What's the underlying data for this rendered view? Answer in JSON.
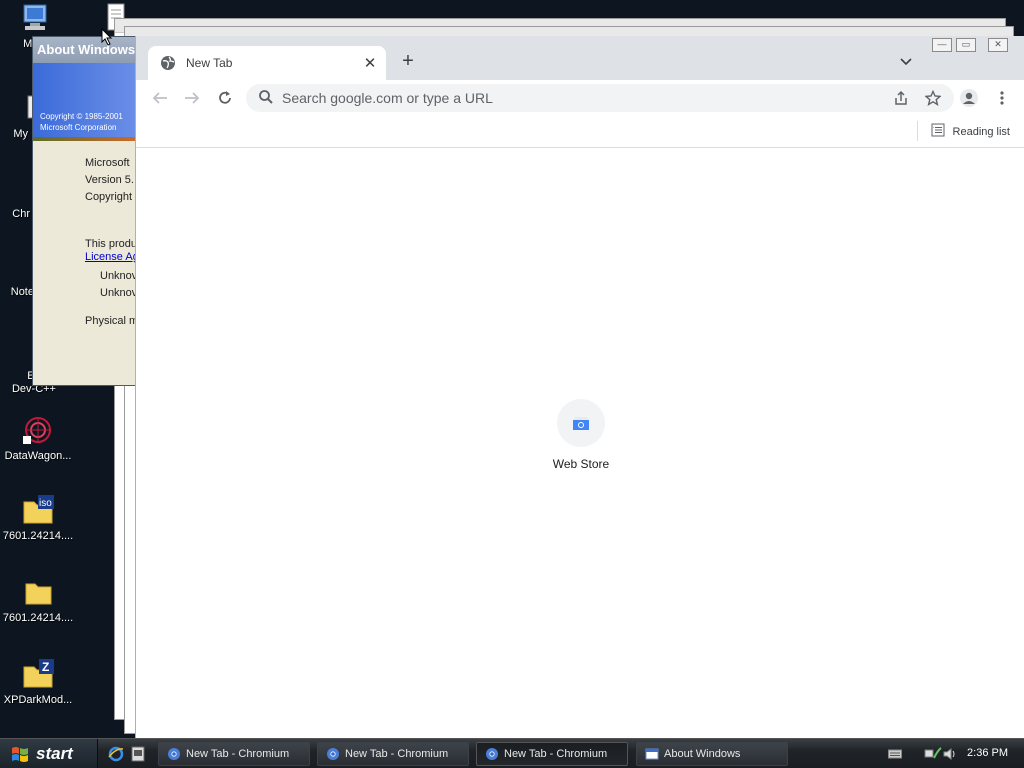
{
  "desktop": {
    "icons": [
      {
        "label": "My C"
      },
      {
        "label": "My"
      },
      {
        "label": "Chr"
      },
      {
        "label": "Note"
      },
      {
        "label": "Emba\nDev-C++"
      },
      {
        "label": "DataWagon..."
      },
      {
        "label": "7601.24214...."
      },
      {
        "label": "7601.24214...."
      },
      {
        "label": "XPDarkMod..."
      }
    ],
    "iso_badge": "iso"
  },
  "about_dialog": {
    "title": "About Windows",
    "banner_line1": "Copyright © 1985-2001",
    "banner_line2": "Microsoft Corporation",
    "lines": [
      "Microsoft",
      "Version 5.",
      "Copyright"
    ],
    "license_text": "This produ",
    "license_link": "License Ag",
    "unknown1": "Unknov",
    "unknown2": "Unknov",
    "physical": "Physical m"
  },
  "browser": {
    "tab_title": "New Tab",
    "new_tab_symbol": "+",
    "omnibox_placeholder": "Search google.com or type a URL",
    "reading_list": "Reading list",
    "shortcut_label": "Web Store"
  },
  "taskbar": {
    "start_label": "start",
    "tasks": [
      {
        "label": "New Tab - Chromium"
      },
      {
        "label": "New Tab - Chromium"
      },
      {
        "label": "New Tab - Chromium"
      },
      {
        "label": "About Windows"
      }
    ],
    "clock": "2:36 PM"
  },
  "colors": {
    "accent_blue": "#1a73e8",
    "tabstrip_bg": "#dee1e6",
    "taskbar_bg": "#202428"
  }
}
